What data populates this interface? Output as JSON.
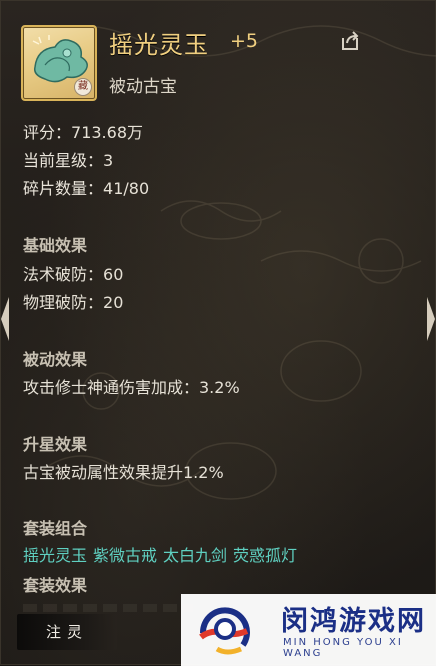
{
  "item": {
    "name": "摇光灵玉",
    "enhance": "+5",
    "type": "被动古宝",
    "stamp": "藏"
  },
  "stats": {
    "score_label": "评分：",
    "score_value": "713.68万",
    "star_label": "当前星级：",
    "star_value": "3",
    "fragment_label": "碎片数量：",
    "fragment_value": "41/80"
  },
  "sections": {
    "base_title": "基础效果",
    "base_effects": [
      {
        "label": "法术破防：",
        "value": "60"
      },
      {
        "label": "物理破防：",
        "value": "20"
      }
    ],
    "passive_title": "被动效果",
    "passive_text": "攻击修士神通伤害加成：3.2%",
    "upgrade_title": "升星效果",
    "upgrade_text": "古宝被动属性效果提升1.2%",
    "set_title": "套装组合",
    "set_items": [
      "摇光灵玉",
      "紫微古戒",
      "太白九剑",
      "荧惑孤灯"
    ],
    "set_effect_title": "套装效果"
  },
  "buttons": {
    "zhuling": "注灵"
  },
  "watermark": {
    "cn": "闵鸿游戏网",
    "en": "MIN HONG YOU XI WANG"
  },
  "icons": {
    "share": "share-icon",
    "prev": "chevron-left-icon",
    "next": "chevron-right-icon"
  },
  "colors": {
    "title": "#f0cf80",
    "set_item": "#5fd0c1",
    "text": "#e6e1d6"
  }
}
